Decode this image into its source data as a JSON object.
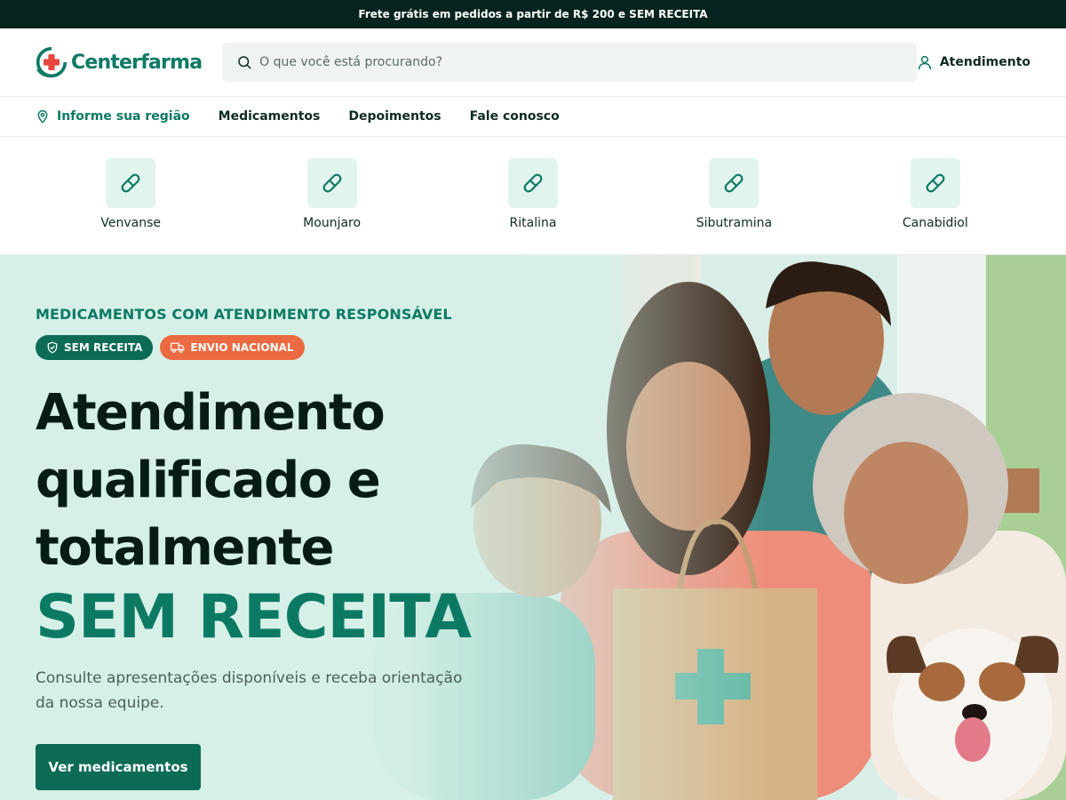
{
  "topbar": {
    "text": "Frete grátis em pedidos a partir de R$ 200 e SEM RECEITA"
  },
  "header": {
    "logo_text": "Centerfarma",
    "search_placeholder": "O que você está procurando?",
    "atendimento_label": "Atendimento"
  },
  "nav": {
    "region_label": "Informe sua região",
    "items": [
      {
        "label": "Medicamentos"
      },
      {
        "label": "Depoimentos"
      },
      {
        "label": "Fale conosco"
      }
    ]
  },
  "categories": [
    {
      "label": "Venvanse",
      "icon": "pill-icon"
    },
    {
      "label": "Mounjaro",
      "icon": "pill-icon"
    },
    {
      "label": "Ritalina",
      "icon": "pill-icon"
    },
    {
      "label": "Sibutramina",
      "icon": "pill-icon"
    },
    {
      "label": "Canabidiol",
      "icon": "pill-icon"
    }
  ],
  "hero": {
    "eyebrow": "MEDICAMENTOS COM ATENDIMENTO RESPONSÁVEL",
    "badges": [
      {
        "label": "SEM RECEITA",
        "icon": "shield-check-icon",
        "color": "#0b6b55"
      },
      {
        "label": "ENVIO NACIONAL",
        "icon": "truck-icon",
        "color": "#ec6a41"
      }
    ],
    "headline_lines": [
      "Atendimento",
      "qualificado e",
      "totalmente"
    ],
    "headline_accent": "SEM RECEITA",
    "subtitle": "Consulte apresentações disponíveis e receba orientação da nossa equipe.",
    "cta_label": "Ver medicamentos"
  },
  "colors": {
    "brand": "#0c7a63",
    "brand_dark": "#0b6b55",
    "accent_orange": "#ec6a41",
    "topbar_bg": "#06241f"
  }
}
